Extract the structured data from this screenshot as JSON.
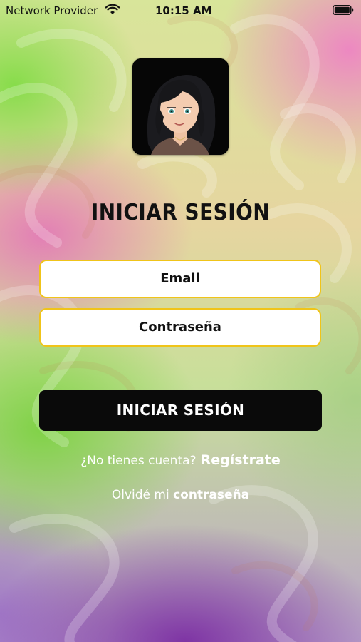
{
  "status_bar": {
    "carrier": "Network Provider",
    "time": "10:15 AM",
    "wifi_icon": "wifi-icon",
    "battery_icon": "battery-icon"
  },
  "avatar": {
    "icon": "user-avatar-illustration"
  },
  "title": "INICIAR SESIÓN",
  "form": {
    "email_placeholder": "Email",
    "password_placeholder": "Contraseña",
    "submit_label": "INICIAR SESIÓN"
  },
  "links": {
    "no_account_text": "¿No tienes cuenta?",
    "register_label": "Regístrate",
    "forgot_prefix": "Olvidé mi",
    "forgot_suffix": "contraseña"
  },
  "colors": {
    "field_border": "#f0c419",
    "button_bg": "#0a0a0a",
    "link_text": "#ffffff"
  }
}
